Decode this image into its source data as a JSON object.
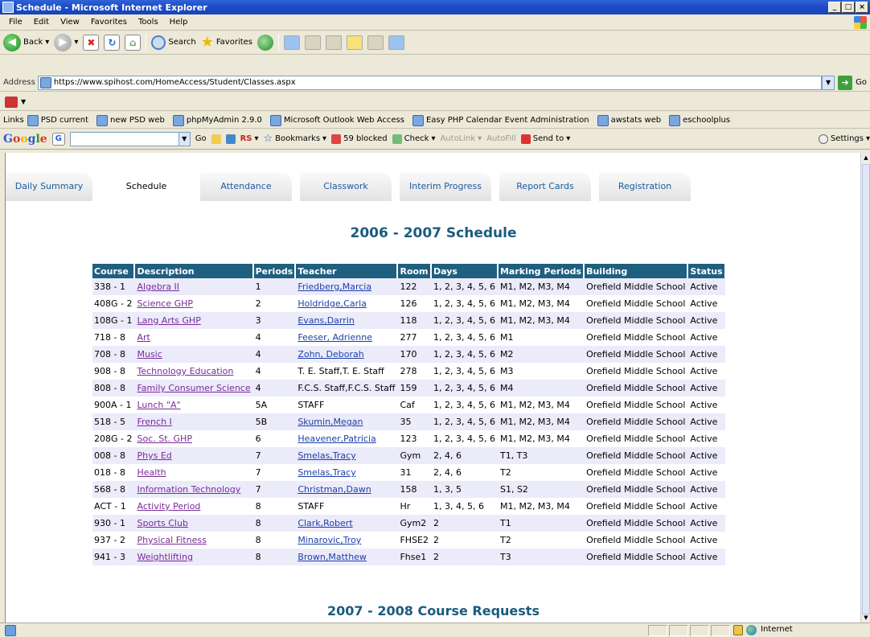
{
  "window": {
    "title": "Schedule - Microsoft Internet Explorer",
    "btn_min": "_",
    "btn_max": "□",
    "btn_close": "×"
  },
  "menu": [
    "File",
    "Edit",
    "View",
    "Favorites",
    "Tools",
    "Help"
  ],
  "toolbar": {
    "back": "Back",
    "search": "Search",
    "favorites": "Favorites"
  },
  "address": {
    "label": "Address",
    "url": "https://www.spihost.com/HomeAccess/Student/Classes.aspx",
    "go": "Go"
  },
  "links": {
    "label": "Links",
    "items": [
      "PSD current",
      "new PSD web",
      "phpMyAdmin 2.9.0",
      "Microsoft Outlook Web Access",
      "Easy PHP Calendar Event Administration",
      "awstats web",
      "eschoolplus"
    ]
  },
  "googlebar": {
    "go": "Go",
    "rs": "RS",
    "bookmarks": "Bookmarks",
    "blocked": "59 blocked",
    "check": "Check",
    "autolink": "AutoLink",
    "autofill": "AutoFill",
    "sendto": "Send to",
    "settings": "Settings"
  },
  "tabs": [
    "Daily Summary",
    "Schedule",
    "Attendance",
    "Classwork",
    "Interim Progress",
    "Report Cards",
    "Registration"
  ],
  "page": {
    "schedule_title": "2006 - 2007 Schedule",
    "requests_title": "2007 - 2008 Course Requests"
  },
  "table": {
    "headers": [
      "Course",
      "Description",
      "Periods",
      "Teacher",
      "Room",
      "Days",
      "Marking Periods",
      "Building",
      "Status"
    ],
    "rows": [
      [
        "338 - 1",
        "Algebra II",
        "1",
        "Friedberg,Marcia",
        "122",
        "1, 2, 3, 4, 5, 6",
        "M1, M2, M3, M4",
        "Orefield Middle School",
        "Active"
      ],
      [
        "408G - 2",
        "Science GHP",
        "2",
        "Holdridge,Carla",
        "126",
        "1, 2, 3, 4, 5, 6",
        "M1, M2, M3, M4",
        "Orefield Middle School",
        "Active"
      ],
      [
        "108G - 1",
        "Lang Arts GHP",
        "3",
        "Evans,Darrin",
        "118",
        "1, 2, 3, 4, 5, 6",
        "M1, M2, M3, M4",
        "Orefield Middle School",
        "Active"
      ],
      [
        "718 - 8",
        "Art",
        "4",
        "Feeser, Adrienne",
        "277",
        "1, 2, 3, 4, 5, 6",
        "M1",
        "Orefield Middle School",
        "Active"
      ],
      [
        "708 - 8",
        "Music",
        "4",
        "Zohn, Deborah",
        "170",
        "1, 2, 3, 4, 5, 6",
        "M2",
        "Orefield Middle School",
        "Active"
      ],
      [
        "908 - 8",
        "Technology Education",
        "4",
        "T. E. Staff,T. E. Staff",
        "278",
        "1, 2, 3, 4, 5, 6",
        "M3",
        "Orefield Middle School",
        "Active"
      ],
      [
        "808 - 8",
        "Family Consumer Science",
        "4",
        "F.C.S. Staff,F.C.S. Staff",
        "159",
        "1, 2, 3, 4, 5, 6",
        "M4",
        "Orefield Middle School",
        "Active"
      ],
      [
        "900A - 1",
        "Lunch \"A\"",
        "5A",
        "STAFF",
        "Caf",
        "1, 2, 3, 4, 5, 6",
        "M1, M2, M3, M4",
        "Orefield Middle School",
        "Active"
      ],
      [
        "518 - 5",
        "French I",
        "5B",
        "Skumin,Megan",
        "35",
        "1, 2, 3, 4, 5, 6",
        "M1, M2, M3, M4",
        "Orefield Middle School",
        "Active"
      ],
      [
        "208G - 2",
        "Soc. St. GHP",
        "6",
        "Heavener,Patricia",
        "123",
        "1, 2, 3, 4, 5, 6",
        "M1, M2, M3, M4",
        "Orefield Middle School",
        "Active"
      ],
      [
        "008 - 8",
        "Phys Ed",
        "7",
        "Smelas,Tracy",
        "Gym",
        "2, 4, 6",
        "T1, T3",
        "Orefield Middle School",
        "Active"
      ],
      [
        "018 - 8",
        "Health",
        "7",
        "Smelas,Tracy",
        "31",
        "2, 4, 6",
        "T2",
        "Orefield Middle School",
        "Active"
      ],
      [
        "568 - 8",
        "Information Technology",
        "7",
        "Christman,Dawn",
        "158",
        "1, 3, 5",
        "S1, S2",
        "Orefield Middle School",
        "Active"
      ],
      [
        "ACT - 1",
        "Activity Period",
        "8",
        "STAFF",
        "Hr",
        "1, 3, 4, 5, 6",
        "M1, M2, M3, M4",
        "Orefield Middle School",
        "Active"
      ],
      [
        "930 - 1",
        "Sports Club",
        "8",
        "Clark,Robert",
        "Gym2",
        "2",
        "T1",
        "Orefield Middle School",
        "Active"
      ],
      [
        "937 - 2",
        "Physical Fitness",
        "8",
        "Minarovic,Troy",
        "FHSE2",
        "2",
        "T2",
        "Orefield Middle School",
        "Active"
      ],
      [
        "941 - 3",
        "Weightlifting",
        "8",
        "Brown,Matthew",
        "Fhse1",
        "2",
        "T3",
        "Orefield Middle School",
        "Active"
      ]
    ],
    "teacher_links": [
      true,
      true,
      true,
      true,
      true,
      false,
      false,
      false,
      true,
      true,
      true,
      true,
      true,
      false,
      true,
      true,
      true
    ]
  },
  "status": {
    "zone": "Internet"
  },
  "colors": {
    "header_bg": "#1f5f7f",
    "title_color": "#1b5b7e",
    "link_purple": "#7a2a9a",
    "link_blue": "#1c3fa8",
    "row_alt": "#ecebfa"
  }
}
